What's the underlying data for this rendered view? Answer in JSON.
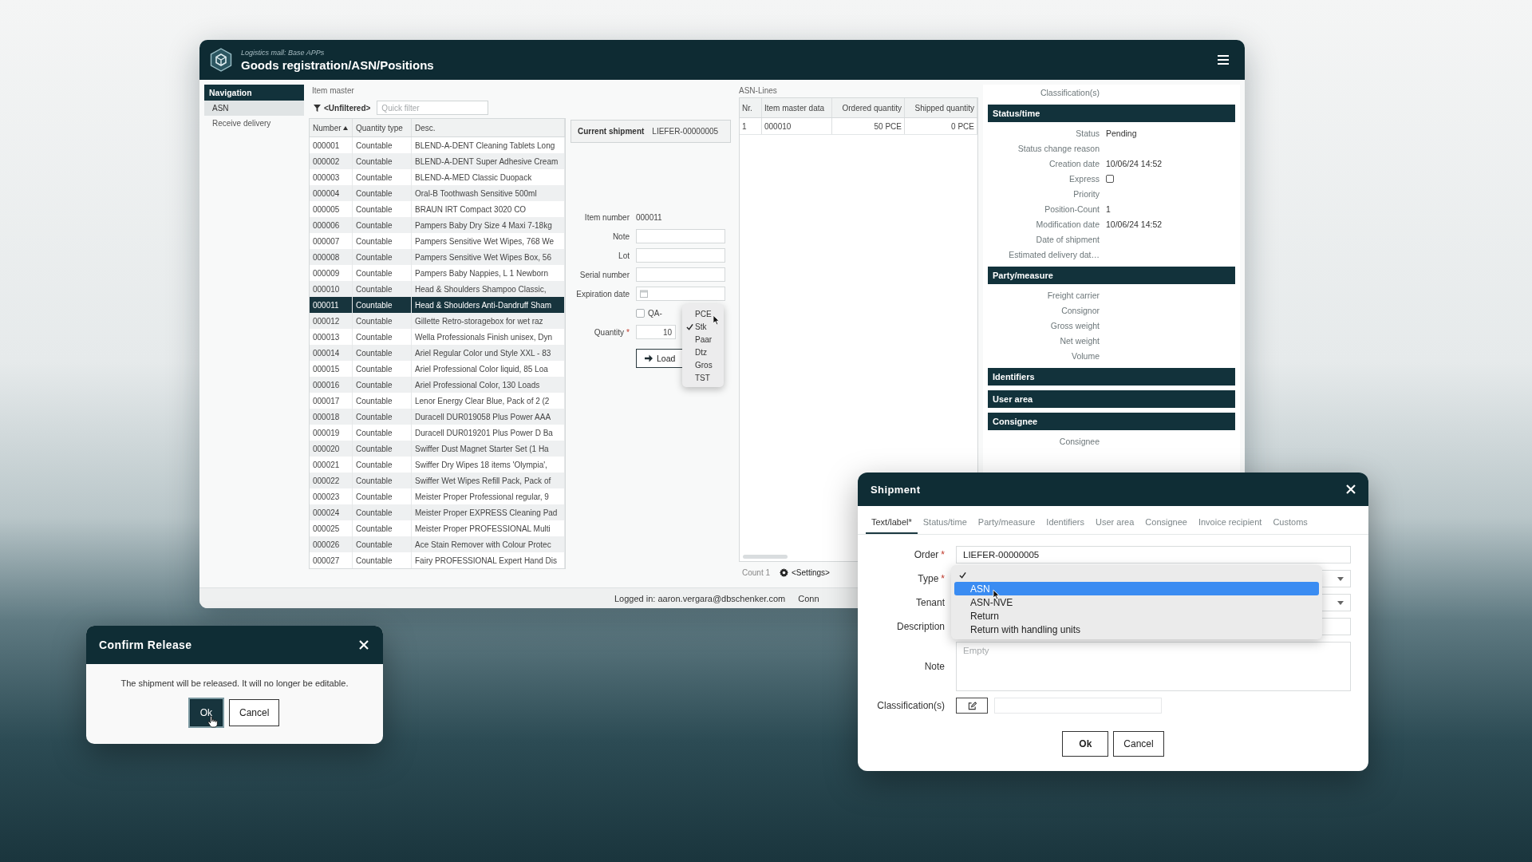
{
  "main_window": {
    "header": {
      "subtitle": "Logistics mall: Base APPs",
      "title": "Goods registration/ASN/Positions"
    },
    "navigation": {
      "title": "Navigation",
      "items": [
        {
          "label": "ASN",
          "selected": true
        },
        {
          "label": "Receive delivery",
          "selected": false
        }
      ]
    },
    "item_master": {
      "title": "Item master",
      "filter": "<Unfiltered>",
      "quick_filter": {
        "placeholder": "Quick filter"
      },
      "columns": [
        {
          "label": "Number",
          "sorted": true
        },
        {
          "label": "Quantity type",
          "sorted": false
        },
        {
          "label": "Desc.",
          "sorted": false
        }
      ],
      "rows": [
        {
          "cells": [
            "000001",
            "Countable",
            "BLEND-A-DENT Cleaning Tablets Long"
          ],
          "selected": false
        },
        {
          "cells": [
            "000002",
            "Countable",
            "BLEND-A-DENT Super Adhesive Cream"
          ],
          "selected": false
        },
        {
          "cells": [
            "000003",
            "Countable",
            "BLEND-A-MED Classic Duopack"
          ],
          "selected": false
        },
        {
          "cells": [
            "000004",
            "Countable",
            "Oral-B Toothwash Sensitive 500ml"
          ],
          "selected": false
        },
        {
          "cells": [
            "000005",
            "Countable",
            "BRAUN IRT Compact 3020 CO"
          ],
          "selected": false
        },
        {
          "cells": [
            "000006",
            "Countable",
            "Pampers Baby Dry Size 4 Maxi 7-18kg"
          ],
          "selected": false
        },
        {
          "cells": [
            "000007",
            "Countable",
            "Pampers Sensitive Wet Wipes, 768 We"
          ],
          "selected": false
        },
        {
          "cells": [
            "000008",
            "Countable",
            "Pampers Sensitive Wet Wipes Box, 56"
          ],
          "selected": false
        },
        {
          "cells": [
            "000009",
            "Countable",
            "Pampers Baby Nappies, L 1 Newborn"
          ],
          "selected": false
        },
        {
          "cells": [
            "000010",
            "Countable",
            "Head & Shoulders Shampoo Classic,"
          ],
          "selected": false
        },
        {
          "cells": [
            "000011",
            "Countable",
            "Head & Shoulders Anti-Dandruff Sham"
          ],
          "selected": true
        },
        {
          "cells": [
            "000012",
            "Countable",
            "Gillette Retro-storagebox for wet raz"
          ],
          "selected": false
        },
        {
          "cells": [
            "000013",
            "Countable",
            "Wella Professionals Finish unisex, Dyn"
          ],
          "selected": false
        },
        {
          "cells": [
            "000014",
            "Countable",
            "Ariel Regular Color und Style XXL - 83"
          ],
          "selected": false
        },
        {
          "cells": [
            "000015",
            "Countable",
            "Ariel Professional Color liquid, 85 Loa"
          ],
          "selected": false
        },
        {
          "cells": [
            "000016",
            "Countable",
            "Ariel Professional Color, 130 Loads"
          ],
          "selected": false
        },
        {
          "cells": [
            "000017",
            "Countable",
            "Lenor Energy Clear Blue, Pack of 2 (2"
          ],
          "selected": false
        },
        {
          "cells": [
            "000018",
            "Countable",
            "Duracell DUR019058 Plus Power AAA"
          ],
          "selected": false
        },
        {
          "cells": [
            "000019",
            "Countable",
            "Duracell DUR019201 Plus Power D Ba"
          ],
          "selected": false
        },
        {
          "cells": [
            "000020",
            "Countable",
            "Swiffer Dust Magnet Starter Set (1 Ha"
          ],
          "selected": false
        },
        {
          "cells": [
            "000021",
            "Countable",
            "Swiffer Dry Wipes 18 items 'Olympia',"
          ],
          "selected": false
        },
        {
          "cells": [
            "000022",
            "Countable",
            "Swiffer Wet Wipes Refill Pack, Pack of"
          ],
          "selected": false
        },
        {
          "cells": [
            "000023",
            "Countable",
            "Meister Proper Professional regular, 9"
          ],
          "selected": false
        },
        {
          "cells": [
            "000024",
            "Countable",
            "Meister Proper EXPRESS Cleaning Pad"
          ],
          "selected": false
        },
        {
          "cells": [
            "000025",
            "Countable",
            "Meister Proper PROFESSIONAL Multi"
          ],
          "selected": false
        },
        {
          "cells": [
            "000026",
            "Countable",
            "Ace Stain Remover with Colour Protec"
          ],
          "selected": false
        },
        {
          "cells": [
            "000027",
            "Countable",
            "Fairy PROFESSIONAL Expert Hand Dis"
          ],
          "selected": false
        }
      ]
    },
    "position_form": {
      "current_shipment": {
        "label": "Current shipment",
        "value": "LIEFER-00000005"
      },
      "fields": [
        {
          "kind": "text",
          "label": "Item number",
          "value": "000011"
        },
        {
          "kind": "input",
          "label": "Note"
        },
        {
          "kind": "input",
          "label": "Lot"
        },
        {
          "kind": "input",
          "label": "Serial number"
        },
        {
          "kind": "date",
          "label": "Expiration date"
        },
        {
          "kind": "checkbox",
          "label": "QA-",
          "checked": false
        },
        {
          "kind": "quantity",
          "label": "Quantity",
          "required_mark": "*",
          "value": "10"
        }
      ],
      "unit_menu": [
        {
          "label": "PCE",
          "checked": false,
          "hovered": true
        },
        {
          "label": "Stk",
          "checked": true,
          "hovered": false
        },
        {
          "label": "Paar",
          "checked": false,
          "hovered": false
        },
        {
          "label": "Dtz",
          "checked": false,
          "hovered": false
        },
        {
          "label": "Gros",
          "checked": false,
          "hovered": false
        },
        {
          "label": "TST",
          "checked": false,
          "hovered": false
        }
      ],
      "load_button": {
        "label": "Load"
      }
    },
    "asn_lines": {
      "title": "ASN-Lines",
      "columns": [
        "Nr.",
        "Item master data",
        "Ordered quantity",
        "Shipped quantity"
      ],
      "rows": [
        [
          "1",
          "000010",
          "50 PCE",
          "0 PCE"
        ]
      ],
      "count": "Count 1",
      "settings": "<Settings>"
    },
    "details": {
      "top_label": "Classification(s)",
      "sections": [
        {
          "title": "Status/time",
          "fields": [
            {
              "kind": "text",
              "label": "Status",
              "value": "Pending"
            },
            {
              "kind": "text",
              "label": "Status change reason"
            },
            {
              "kind": "text",
              "label": "Creation date",
              "value": "10/06/24 14:52"
            },
            {
              "kind": "checkbox",
              "label": "Express",
              "checked": false
            },
            {
              "kind": "text",
              "label": "Priority"
            },
            {
              "kind": "text",
              "label": "Position-Count",
              "value": "1"
            },
            {
              "kind": "text",
              "label": "Modification date",
              "value": "10/06/24 14:52"
            },
            {
              "kind": "text",
              "label": "Date of shipment"
            },
            {
              "kind": "text",
              "label": "Estimated delivery dat…"
            }
          ]
        },
        {
          "title": "Party/measure",
          "fields": [
            {
              "kind": "text",
              "label": "Freight carrier"
            },
            {
              "kind": "text",
              "label": "Consignor"
            },
            {
              "kind": "text",
              "label": "Gross weight"
            },
            {
              "kind": "text",
              "label": "Net weight"
            },
            {
              "kind": "text",
              "label": "Volume"
            }
          ]
        },
        {
          "title": "Identifiers"
        },
        {
          "title": "User area"
        },
        {
          "title": "Consignee",
          "fields": [
            {
              "kind": "text",
              "label": "Consignee"
            }
          ]
        }
      ]
    },
    "status_bar": {
      "logged_in": "Logged in: aaron.vergara@dbschenker.com",
      "connection": "Conn"
    }
  },
  "shipment_dialog": {
    "title": "Shipment",
    "tabs": [
      {
        "label": "Text/label*",
        "selected": true
      },
      {
        "label": "Status/time",
        "selected": false
      },
      {
        "label": "Party/measure",
        "selected": false
      },
      {
        "label": "Identifiers",
        "selected": false
      },
      {
        "label": "User area",
        "selected": false
      },
      {
        "label": "Consignee",
        "selected": false
      },
      {
        "label": "Invoice recipient",
        "selected": false
      },
      {
        "label": "Customs",
        "selected": false
      }
    ],
    "fields": [
      {
        "kind": "text",
        "label": "Order",
        "required_mark": "*",
        "value": "LIEFER-00000005"
      },
      {
        "kind": "select",
        "label": "Type",
        "required_mark": "*",
        "open": true,
        "options": [
          {
            "checked": true,
            "selected": false,
            "hovered": false
          },
          {
            "label": "ASN",
            "checked": false,
            "selected": true,
            "hovered": true
          },
          {
            "label": "ASN-NVE",
            "checked": false,
            "selected": false,
            "hovered": false
          },
          {
            "label": "Return",
            "checked": false,
            "selected": false,
            "hovered": false
          },
          {
            "label": "Return with handling units",
            "checked": false,
            "selected": false,
            "hovered": false
          }
        ]
      },
      {
        "kind": "select",
        "label": "Tenant",
        "open": false
      },
      {
        "kind": "text",
        "label": "Description"
      },
      {
        "kind": "textarea",
        "label": "Note",
        "placeholder": "Empty"
      },
      {
        "kind": "classification",
        "label": "Classification(s)"
      }
    ],
    "buttons": [
      {
        "label": "Ok",
        "default": true
      },
      {
        "label": "Cancel",
        "default": false
      }
    ]
  },
  "confirm_dialog": {
    "title": "Confirm Release",
    "message": "The shipment will be released. It will no longer be editable.",
    "buttons": [
      {
        "label": "Ok",
        "focused": true,
        "hovered": true
      },
      {
        "label": "Cancel",
        "focused": false,
        "hovered": false
      }
    ]
  }
}
